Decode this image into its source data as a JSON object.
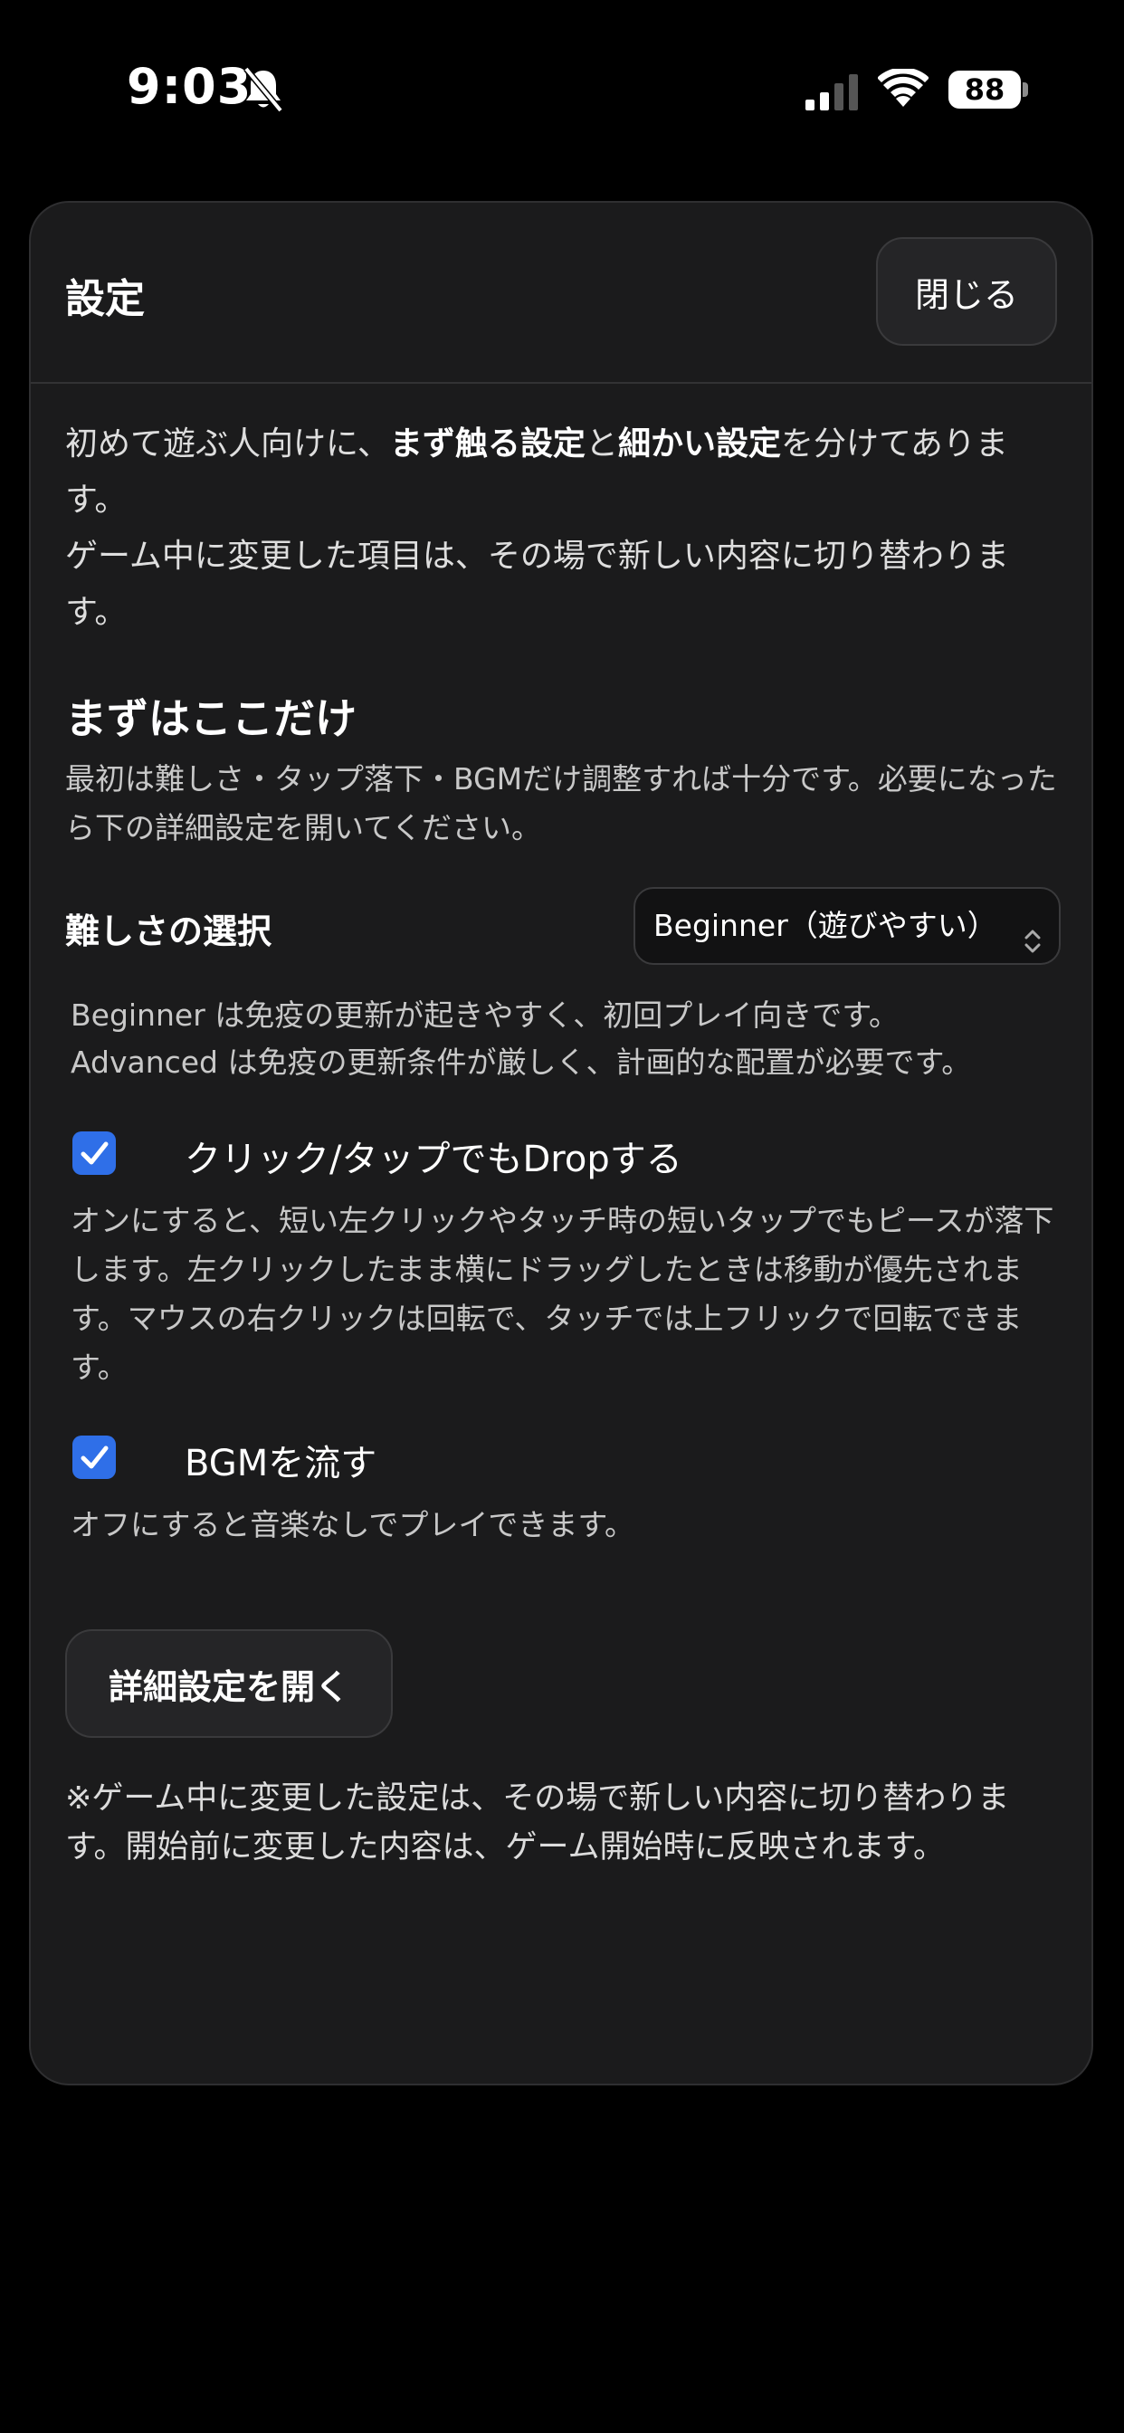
{
  "status_bar": {
    "time": "9:03",
    "battery": "88",
    "icons": [
      "bell-slash-icon",
      "signal-icon",
      "wifi-icon",
      "battery-icon"
    ]
  },
  "dialog": {
    "title": "設定",
    "close_label": "閉じる"
  },
  "intro": {
    "part1": "初めて遊ぶ人向けに、",
    "bold1": "まず触る設定",
    "part2": "と",
    "bold2": "細かい設定",
    "part3": "を分けてあります。",
    "line2": "ゲーム中に変更した項目は、その場で新しい内容に切り替わります。"
  },
  "quick_section": {
    "title": "まずはここだけ",
    "description": "最初は難しさ・タップ落下・BGMだけ調整すれば十分です。必要になったら下の詳細設定を開いてください。"
  },
  "difficulty": {
    "label": "難しさの選択",
    "selected": "Beginner（遊びやすい）",
    "help_line1": "Beginner は免疫の更新が起きやすく、初回プレイ向きです。",
    "help_line2": "Advanced は免疫の更新条件が厳しく、計画的な配置が必要です。"
  },
  "tap_drop": {
    "label": "クリック/タップでもDropする",
    "checked": true,
    "description": "オンにすると、短い左クリックやタッチ時の短いタップでもピースが落下します。左クリックしたまま横にドラッグしたときは移動が優先されます。マウスの右クリックは回転で、タッチでは上フリックで回転できます。"
  },
  "bgm": {
    "label": "BGMを流す",
    "checked": true,
    "description": "オフにすると音楽なしでプレイできます。"
  },
  "advanced_button_label": "詳細設定を開く",
  "footnote": "※ゲーム中に変更した設定は、その場で新しい内容に切り替わります。開始前に変更した内容は、ゲーム開始時に反映されます。",
  "colors": {
    "background": "#000000",
    "panel": "#1b1b1c",
    "checkbox_accent": "#2f6fe8"
  }
}
